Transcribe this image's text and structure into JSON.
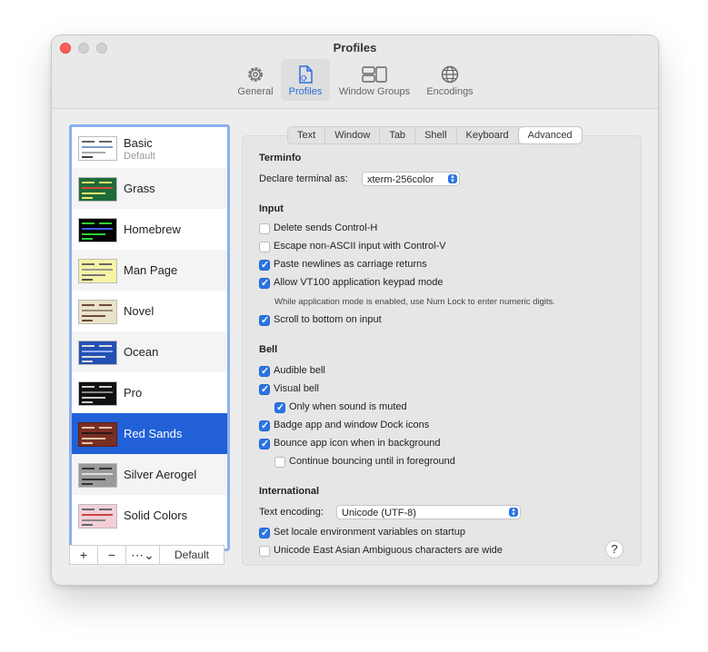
{
  "window": {
    "title": "Profiles"
  },
  "toolbar": {
    "general": "General",
    "profiles": "Profiles",
    "window_groups": "Window Groups",
    "encodings": "Encodings"
  },
  "profiles": [
    {
      "name": "Basic",
      "sub": "Default"
    },
    {
      "name": "Grass"
    },
    {
      "name": "Homebrew"
    },
    {
      "name": "Man Page"
    },
    {
      "name": "Novel"
    },
    {
      "name": "Ocean"
    },
    {
      "name": "Pro"
    },
    {
      "name": "Red Sands"
    },
    {
      "name": "Silver Aerogel"
    },
    {
      "name": "Solid Colors"
    }
  ],
  "profile_buttons": {
    "add": "+",
    "remove": "−",
    "more": "⋯⌄",
    "default": "Default"
  },
  "tabs": [
    "Text",
    "Window",
    "Tab",
    "Shell",
    "Keyboard",
    "Advanced"
  ],
  "terminfo": {
    "heading": "Terminfo",
    "declare_label": "Declare terminal as:",
    "declare_value": "xterm-256color"
  },
  "input": {
    "heading": "Input",
    "delete_ctrl_h": "Delete sends Control-H",
    "escape_non_ascii": "Escape non-ASCII input with Control-V",
    "paste_newlines": "Paste newlines as carriage returns",
    "vt100_keypad": "Allow VT100 application keypad mode",
    "vt100_note": "While application mode is enabled, use Num Lock to enter numeric digits.",
    "scroll_bottom": "Scroll to bottom on input"
  },
  "bell": {
    "heading": "Bell",
    "audible": "Audible bell",
    "visual": "Visual bell",
    "only_muted": "Only when sound is muted",
    "badge": "Badge app and window Dock icons",
    "bounce": "Bounce app icon when in background",
    "continue_bounce": "Continue bouncing until in foreground"
  },
  "international": {
    "heading": "International",
    "encoding_label": "Text encoding:",
    "encoding_value": "Unicode (UTF-8)",
    "set_locale": "Set locale environment variables on startup",
    "east_asian": "Unicode East Asian Ambiguous characters are wide"
  },
  "help": "?",
  "colors": {
    "accent": "#2a74e6",
    "selection": "#2260d8"
  }
}
